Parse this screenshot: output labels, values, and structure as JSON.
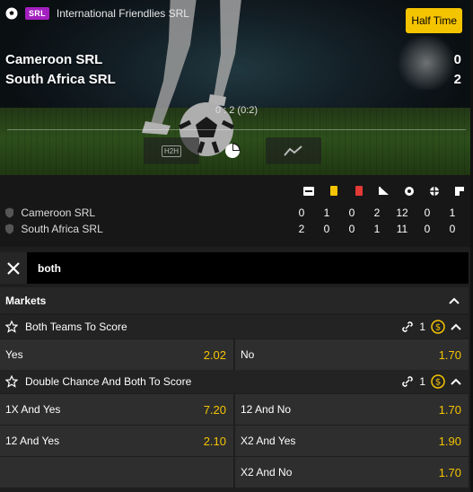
{
  "header": {
    "srl_badge": "SRL",
    "league": "International Friendlies SRL",
    "status_button": "Half Time"
  },
  "teams": [
    {
      "name": "Cameroon SRL",
      "score": "0"
    },
    {
      "name": "South Africa SRL",
      "score": "2"
    }
  ],
  "halftime_score": "0 : 2  (0:2)",
  "view_tabs": {
    "h2h_label": "H2H"
  },
  "stats": {
    "columns": [
      "corners-icon",
      "yellow-card-icon",
      "red-card-icon",
      "penalty-icon",
      "shots-on-target-icon",
      "shots-off-target-icon",
      "substitution-icon"
    ],
    "rows": [
      {
        "team": "Cameroon SRL",
        "values": [
          "0",
          "1",
          "0",
          "2",
          "12",
          "0",
          "1"
        ]
      },
      {
        "team": "South Africa SRL",
        "values": [
          "2",
          "0",
          "0",
          "1",
          "11",
          "0",
          "0"
        ]
      }
    ]
  },
  "search": {
    "value": "both"
  },
  "markets_label": "Markets",
  "markets": [
    {
      "name": "Both Teams To Score",
      "link_count": "1",
      "outcomes": [
        {
          "label": "Yes",
          "price": "2.02"
        },
        {
          "label": "No",
          "price": "1.70"
        }
      ]
    },
    {
      "name": "Double Chance And Both To Score",
      "link_count": "1",
      "outcomes": [
        {
          "label": "1X And Yes",
          "price": "7.20"
        },
        {
          "label": "12 And No",
          "price": "1.70"
        },
        {
          "label": "12 And Yes",
          "price": "2.10"
        },
        {
          "label": "X2 And Yes",
          "price": "1.90"
        },
        {
          "label": "X2 And No",
          "price": "1.70"
        }
      ]
    }
  ],
  "colors": {
    "accent": "#f5c400",
    "srl_badge": "#a31fbf",
    "yellow_card": "#f5c400",
    "red_card": "#e53935"
  }
}
